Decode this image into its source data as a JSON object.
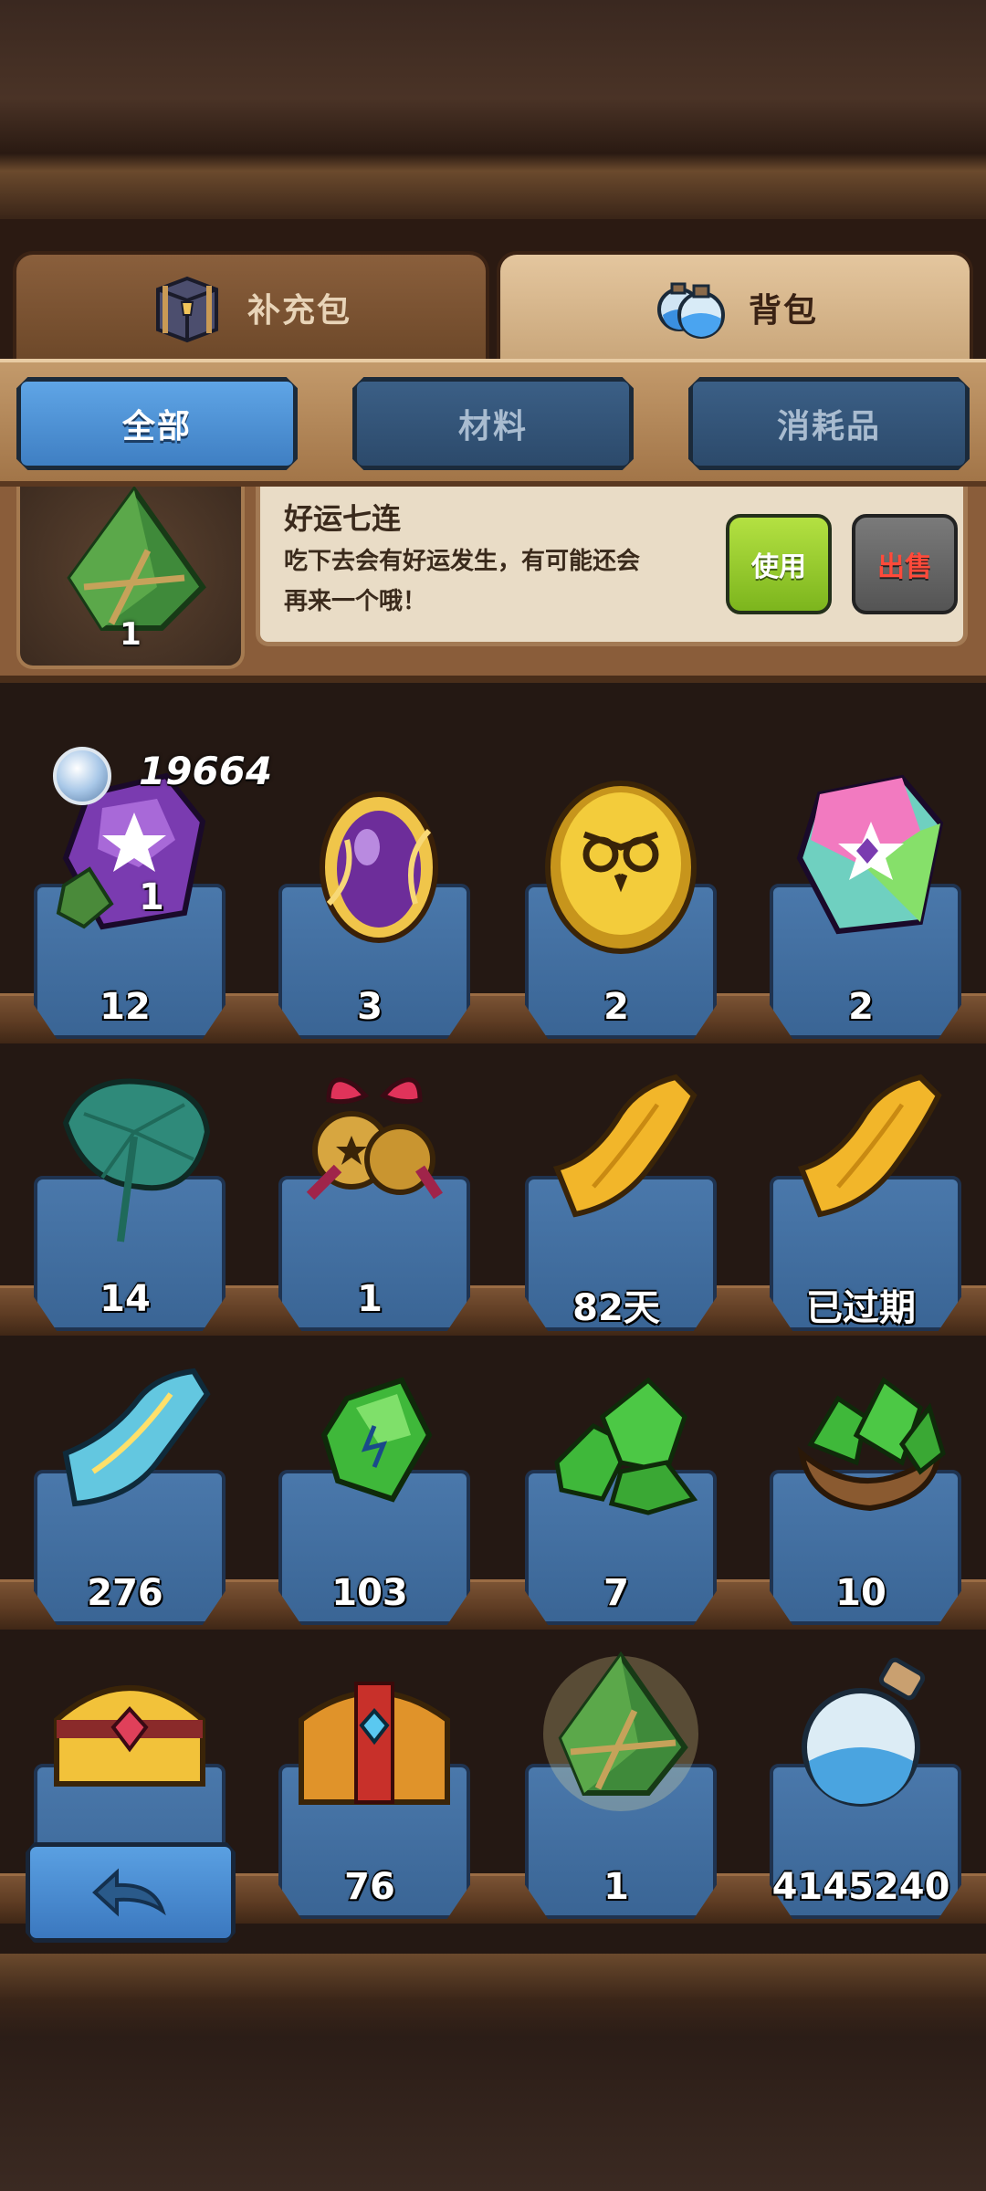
{
  "main_tabs": [
    {
      "label": "补充包",
      "icon": "chest-icon",
      "active": false
    },
    {
      "label": "背包",
      "icon": "potion-icon",
      "active": true
    }
  ],
  "sub_tabs": [
    {
      "label": "全部",
      "active": true
    },
    {
      "label": "材料",
      "active": false
    },
    {
      "label": "消耗品",
      "active": false
    }
  ],
  "detail": {
    "icon": "zongzi-icon",
    "count": "1",
    "name": "好运七连",
    "desc_line1": "吃下去会有好运发生，有可能还会",
    "desc_line2": "再来一个哦！",
    "use_label": "使用",
    "sell_label": "出售"
  },
  "currency": {
    "icon": "diamond-coin-icon",
    "value": "19664"
  },
  "items": [
    {
      "icon": "purple-star-gem-with-zongzi-icon",
      "count": "12",
      "badge": "1"
    },
    {
      "icon": "purple-egg-icon",
      "count": "3"
    },
    {
      "icon": "gold-owl-coin-icon",
      "count": "2"
    },
    {
      "icon": "rainbow-star-gem-icon",
      "count": "2"
    },
    {
      "icon": "lotus-leaf-icon",
      "count": "14"
    },
    {
      "icon": "gold-bells-icon",
      "count": "1"
    },
    {
      "icon": "gold-scroll-icon",
      "count": "82天"
    },
    {
      "icon": "gold-scroll-icon",
      "count": "已过期"
    },
    {
      "icon": "blue-ticket-icon",
      "count": "276"
    },
    {
      "icon": "green-crystal-icon",
      "count": "103"
    },
    {
      "icon": "green-crystal-pile-icon",
      "count": "7"
    },
    {
      "icon": "green-crystal-sack-icon",
      "count": "10"
    },
    {
      "icon": "gold-treasure-chest-icon",
      "count": ""
    },
    {
      "icon": "red-treasure-chest-icon",
      "count": "76"
    },
    {
      "icon": "zongzi-icon",
      "count": "1"
    },
    {
      "icon": "blue-powder-bottle-icon",
      "count": "4145240"
    }
  ],
  "colors": {
    "accent_blue": "#4a8fd6",
    "use_green": "#8cc523",
    "sell_red": "#ff4a3a",
    "wood": "#8a5d3a"
  },
  "back_button": {
    "icon": "back-arrow-icon"
  }
}
